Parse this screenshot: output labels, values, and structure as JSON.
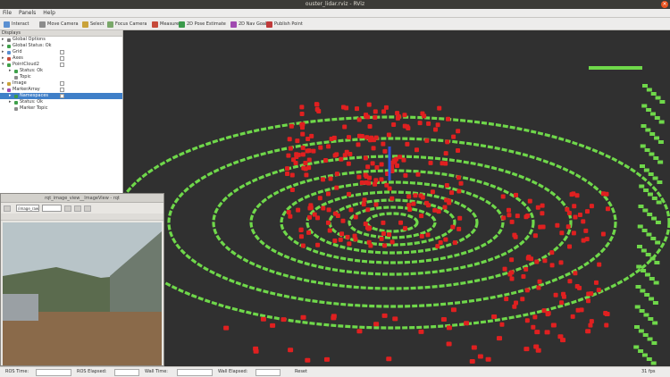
{
  "window": {
    "title": "ouster_lidar.rviz - RViz",
    "close_symbol": "×"
  },
  "menu": [
    "File",
    "Panels",
    "Help"
  ],
  "toolbar": [
    {
      "label": "Interact",
      "color": "#5a8fd1"
    },
    {
      "label": "Move Camera",
      "color": "#8c8c8c"
    },
    {
      "label": "Select",
      "color": "#c9a23a"
    },
    {
      "label": "Focus Camera",
      "color": "#7aa86a"
    },
    {
      "label": "Measure",
      "color": "#c64a3a"
    },
    {
      "label": "2D Pose Estimate",
      "color": "#3a9a4a"
    },
    {
      "label": "2D Nav Goal",
      "color": "#a04ab0"
    },
    {
      "label": "Publish Point",
      "color": "#c03a3a"
    }
  ],
  "displays": {
    "header": "Displays",
    "items": [
      {
        "label": "Global Options",
        "indent": 0,
        "arrow": "▸",
        "icon": "#7a7a7a",
        "check": false
      },
      {
        "label": "Global Status: Ok",
        "indent": 0,
        "arrow": "▸",
        "icon": "#3fa04a",
        "check": false
      },
      {
        "label": "Grid",
        "indent": 0,
        "arrow": "▸",
        "icon": "#5a8fd1",
        "check": true
      },
      {
        "label": "Axes",
        "indent": 0,
        "arrow": "▸",
        "icon": "#c64a3a",
        "check": true
      },
      {
        "label": "PointCloud2",
        "indent": 0,
        "arrow": "▾",
        "icon": "#3fa04a",
        "check": true
      },
      {
        "label": "Status: Ok",
        "indent": 1,
        "arrow": "▸",
        "icon": "#3fa04a",
        "check": false
      },
      {
        "label": "Topic",
        "indent": 1,
        "arrow": "",
        "icon": "#8c8c8c",
        "check": false
      },
      {
        "label": "Image",
        "indent": 0,
        "arrow": "▸",
        "icon": "#c9a23a",
        "check": true
      },
      {
        "label": "MarkerArray",
        "indent": 0,
        "arrow": "▾",
        "icon": "#a04ab0",
        "check": true
      },
      {
        "label": "Namespaces",
        "indent": 1,
        "arrow": "▸",
        "icon": "#3a9a4a",
        "check": true,
        "selected": true
      },
      {
        "label": "Status: Ok",
        "indent": 1,
        "arrow": "▸",
        "icon": "#3fa04a",
        "check": false
      },
      {
        "label": "Marker Topic",
        "indent": 1,
        "arrow": "",
        "icon": "#8c8c8c",
        "check": false
      }
    ]
  },
  "camera_window": {
    "title": "rqt_image_view__ImageView - rqt",
    "topic": "/image_raw",
    "road_label": "",
    "colors": {
      "sky": "#b8c4c8",
      "road": "#8a6a4a",
      "building": "#6e7a6e"
    }
  },
  "status": {
    "reset_label": "Reset",
    "fps_label": "31 fps",
    "ros_time_label": "ROS Time:",
    "ros_elapsed_label": "ROS Elapsed:",
    "wall_time_label": "Wall Time:",
    "wall_elapsed_label": "Wall Elapsed:"
  },
  "viewport": {
    "background": "#303030",
    "ring_color": "#6fd84a",
    "point_color": "#e02020",
    "axis_color": "#3050d8"
  }
}
